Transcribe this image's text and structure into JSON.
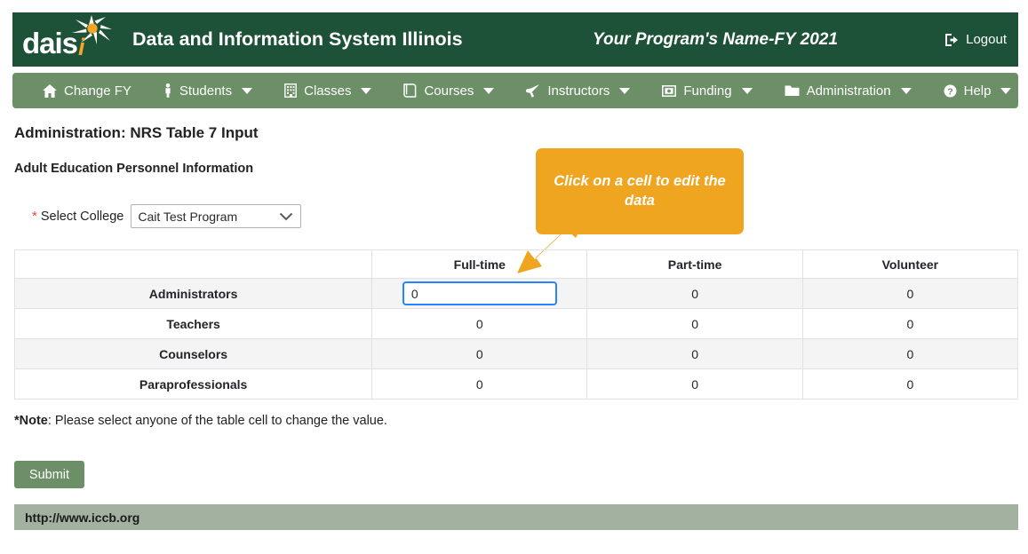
{
  "header": {
    "logo_text": "dais",
    "logo_accent": "i",
    "logo_icon": "starburst-icon",
    "title": "Data and Information System Illinois",
    "program": "Your Program's Name-FY 2021",
    "logout_label": "Logout",
    "bg_color": "#1d5239"
  },
  "nav": {
    "bg_color": "#6d8f67",
    "items": [
      {
        "label": "Change FY",
        "icon": "home-icon",
        "caret": false
      },
      {
        "label": "Students",
        "icon": "person-icon",
        "caret": true
      },
      {
        "label": "Classes",
        "icon": "building-icon",
        "caret": true
      },
      {
        "label": "Courses",
        "icon": "book-icon",
        "caret": true
      },
      {
        "label": "Instructors",
        "icon": "bullhorn-icon",
        "caret": true
      },
      {
        "label": "Funding",
        "icon": "money-icon",
        "caret": true
      },
      {
        "label": "Administration",
        "icon": "folder-icon",
        "caret": true
      },
      {
        "label": "Help",
        "icon": "question-circle-icon",
        "caret": true
      }
    ]
  },
  "main": {
    "page_title": "Administration: NRS Table 7 Input",
    "section_title": "Adult Education Personnel Information",
    "select_college": {
      "required_mark": "*",
      "label": "Select College",
      "value": "Cait Test Program",
      "options": [
        "Cait Test Program"
      ]
    },
    "callout": {
      "text": "Click on a cell to edit the data",
      "color": "#f0a521"
    },
    "table": {
      "corner_header": "",
      "columns": [
        "Full-time",
        "Part-time",
        "Volunteer"
      ],
      "rows": [
        {
          "label": "Administrators",
          "values": [
            "0",
            "0",
            "0"
          ],
          "active_cell": 0
        },
        {
          "label": "Teachers",
          "values": [
            "0",
            "0",
            "0"
          ],
          "active_cell": -1
        },
        {
          "label": "Counselors",
          "values": [
            "0",
            "0",
            "0"
          ],
          "active_cell": -1
        },
        {
          "label": "Paraprofessionals",
          "values": [
            "0",
            "0",
            "0"
          ],
          "active_cell": -1
        }
      ]
    },
    "note_prefix": "*Note",
    "note_text": ": Please select anyone of the table cell to change the value.",
    "submit_label": "Submit"
  },
  "footer": {
    "url": "http://www.iccb.org",
    "bg_color": "#a3b1a0"
  }
}
